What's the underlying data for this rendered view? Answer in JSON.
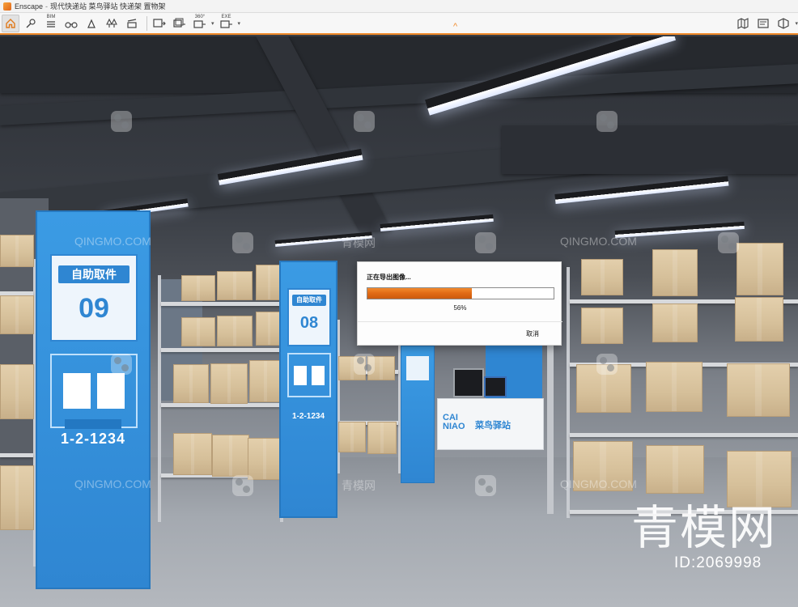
{
  "window": {
    "app_name": "Enscape",
    "separator": "-",
    "document_title": "现代快递站 菜鸟驿站 快递架 置物架"
  },
  "toolbar": {
    "left_icons": [
      "home-icon",
      "capture-point-icon",
      "bim-icon",
      "binoculars-icon",
      "sun-icon",
      "trees-icon",
      "clapper-icon",
      "export-image-icon",
      "batch-export-icon",
      "panorama-export-icon",
      "exe-export-icon",
      "web-export-icon"
    ],
    "bim_label": "BIM",
    "pano_label": "360°",
    "exe_label": "EXE",
    "right_icons": [
      "map-icon",
      "material-editor-icon",
      "settings-cube-icon"
    ],
    "collapse_glyph": "^"
  },
  "scene": {
    "panel_09": {
      "tag": "自助取件",
      "number": "09",
      "code": "1-2-1234"
    },
    "panel_08": {
      "tag": "自助取件",
      "number": "08",
      "code": "1-2-1234"
    },
    "desk_logo_text": "菜鸟驿站",
    "desk_logo_latin": "CAI NIAO",
    "watermark_text": "QINGMO.COM",
    "watermark_cn": "青模网",
    "brand_big": "青模网",
    "brand_id": "ID:2069998"
  },
  "export_dialog": {
    "title": "正在导出图像...",
    "progress_fraction": 0.56,
    "progress_text": "56%",
    "cancel_label": "取消"
  },
  "colors": {
    "accent_orange": "#f08a2a",
    "progress_fill": "#e06a15",
    "panel_blue": "#2f86d2"
  }
}
